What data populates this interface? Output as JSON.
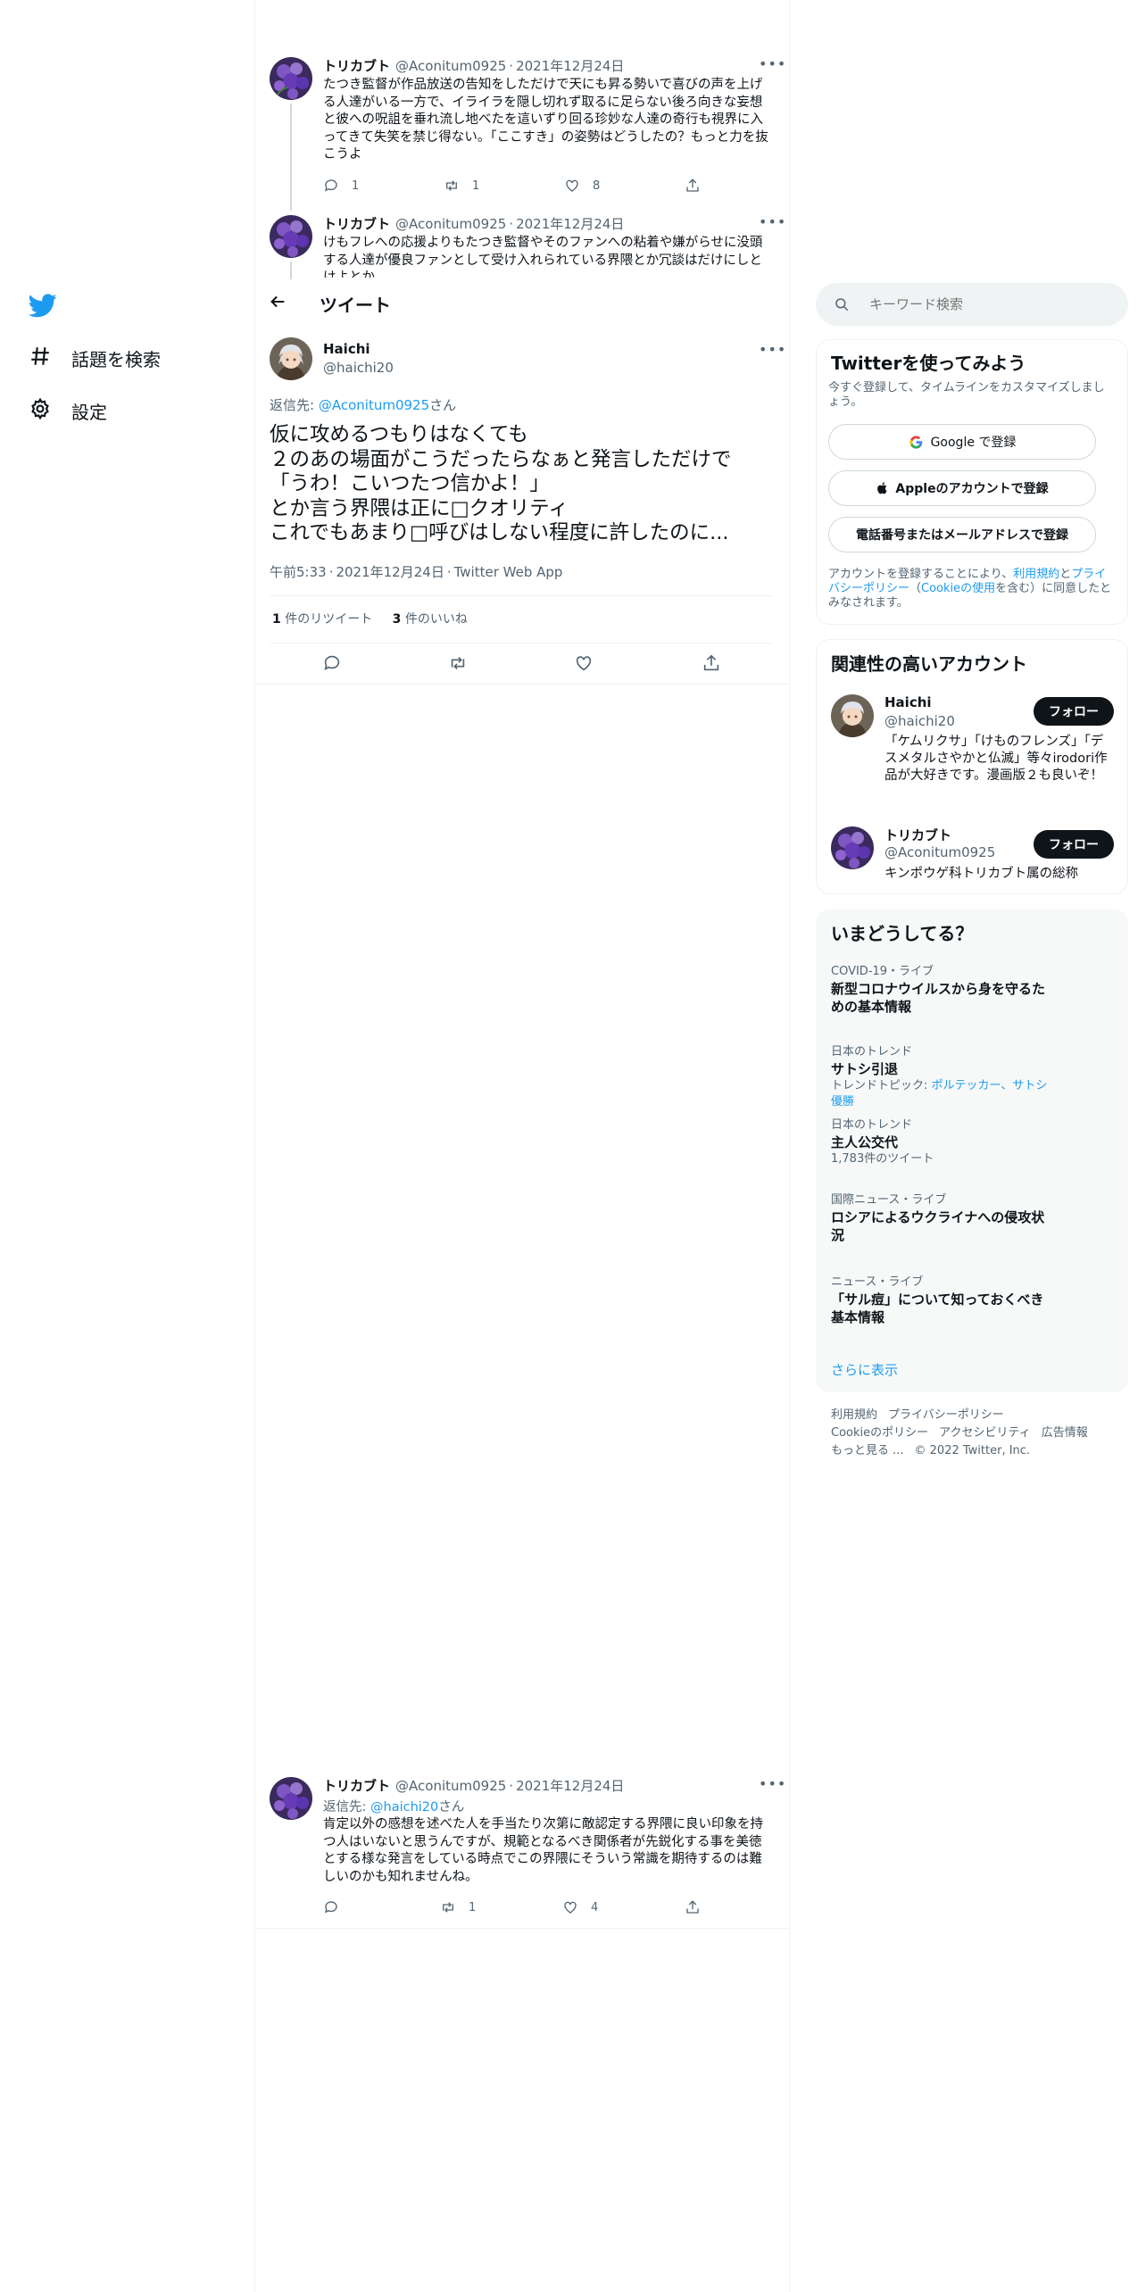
{
  "nav": {
    "explore_label": "話題を検索",
    "settings_label": "設定"
  },
  "header": {
    "title": "ツイート"
  },
  "thread_top": [
    {
      "name": "トリカブト",
      "handle": "@Aconitum0925",
      "sep": "·",
      "date": "2021年12月24日",
      "text": "たつき監督が作品放送の告知をしただけで天にも昇る勢いで喜びの声を上げる人達がいる一方で、イライラを隠し切れず取るに足らない後ろ向きな妄想と彼への呪詛を垂れ流し地べたを這いずり回る珍妙な人達の奇行も視界に入ってきて失笑を禁じ得ない。「ここすき」の姿勢はどうしたの？もっと力を抜こうよ",
      "replies": "1",
      "retweets": "1",
      "likes": "8"
    },
    {
      "name": "トリカブト",
      "handle": "@Aconitum0925",
      "sep": "·",
      "date": "2021年12月24日",
      "text": "けもフレへの応援よりもたつき監督やそのファンへの粘着や嫌がらせに没頭する人達が優良ファンとして受け入れられている界隈とか冗談はだけにしとけよとか"
    }
  ],
  "main_tweet": {
    "name": "Haichi",
    "handle": "@haichi20",
    "reply_prefix": "返信先:",
    "reply_to": "@Aconitum0925",
    "reply_suffix": "さん",
    "text_lines": [
      "仮に攻めるつもりはなくても",
      "２のあの場面がこうだったらなぁと発言しただけで",
      "「うわ！こいつたつ信かよ！」",
      "とか言う界隈は正に□クオリティ",
      "これでもあまり□呼びはしない程度に許したのに..."
    ],
    "time": "午前5:33",
    "sep": "·",
    "date": "2021年12月24日",
    "source": "Twitter Web App",
    "retweet_count": "1",
    "retweet_label": "件のリツイート",
    "like_count": "3",
    "like_label": "件のいいね"
  },
  "reply_tweet": {
    "name": "トリカブト",
    "handle": "@Aconitum0925",
    "sep": "·",
    "date": "2021年12月24日",
    "reply_prefix": "返信先:",
    "reply_to": "@haichi20",
    "reply_suffix": "さん",
    "text": "肯定以外の感想を述べた人を手当たり次第に敵認定する界隈に良い印象を持つ人はいないと思うんですが、規範となるべき関係者が先鋭化する事を美徳とする様な発言をしている時点でこの界隈にそういう常識を期待するのは難しいのかも知れませんね。",
    "retweets": "1",
    "likes": "4"
  },
  "search": {
    "placeholder": "キーワード検索"
  },
  "signup": {
    "title": "Twitterを使ってみよう",
    "subtitle": "今すぐ登録して、タイムラインをカスタマイズしましょう。",
    "google_label": "Google で登録",
    "apple_label": "Appleのアカウントで登録",
    "phone_label": "電話番号またはメールアドレスで登録",
    "legal_1": "アカウントを登録することにより、",
    "legal_terms": "利用規約",
    "legal_2": "と",
    "legal_privacy": "プライバシーポリシー",
    "legal_3": "（",
    "legal_cookie": "Cookieの使用",
    "legal_4": "を含む）に同意したとみなされます。"
  },
  "related": {
    "title": "関連性の高いアカウント",
    "accounts": [
      {
        "name": "Haichi",
        "handle": "@haichi20",
        "bio": "「ケムリクサ」「けものフレンズ」「デスメタルさやかと仏滅」等々irodori作品が大好きです。漫画版２も良いぞ！",
        "follow_label": "フォロー"
      },
      {
        "name": "トリカブト",
        "handle": "@Aconitum0925",
        "bio": "キンポウゲ科トリカブト属の総称",
        "follow_label": "フォロー"
      }
    ]
  },
  "trends": {
    "title": "いまどうしてる？",
    "items": [
      {
        "context": "COVID-19・ライブ",
        "title": "新型コロナウイルスから身を守るための基本情報",
        "sub": ""
      },
      {
        "context": "日本のトレンド",
        "title": "サトシ引退",
        "sub_prefix": "トレンドトピック:",
        "sub_link": "ポルテッカー、サトシ優勝"
      },
      {
        "context": "日本のトレンド",
        "title": "主人公交代",
        "sub": "1,783件のツイート"
      },
      {
        "context": "国際ニュース・ライブ",
        "title": "ロシアによるウクライナへの侵攻状況",
        "sub": ""
      },
      {
        "context": "ニュース・ライブ",
        "title": "「サル痘」について知っておくべき基本情報",
        "sub": ""
      }
    ],
    "more_label": "さらに表示"
  },
  "footer": {
    "terms": "利用規約",
    "privacy": "プライバシーポリシー",
    "cookie": "Cookieのポリシー",
    "accessibility": "アクセシビリティ",
    "ads": "広告情報",
    "more": "もっと見る ...",
    "copyright": "© 2022 Twitter, Inc."
  },
  "colors": {
    "accent": "#1d9bf0",
    "text": "#0f1419",
    "secondary": "#536471",
    "border": "#eff3f4"
  }
}
